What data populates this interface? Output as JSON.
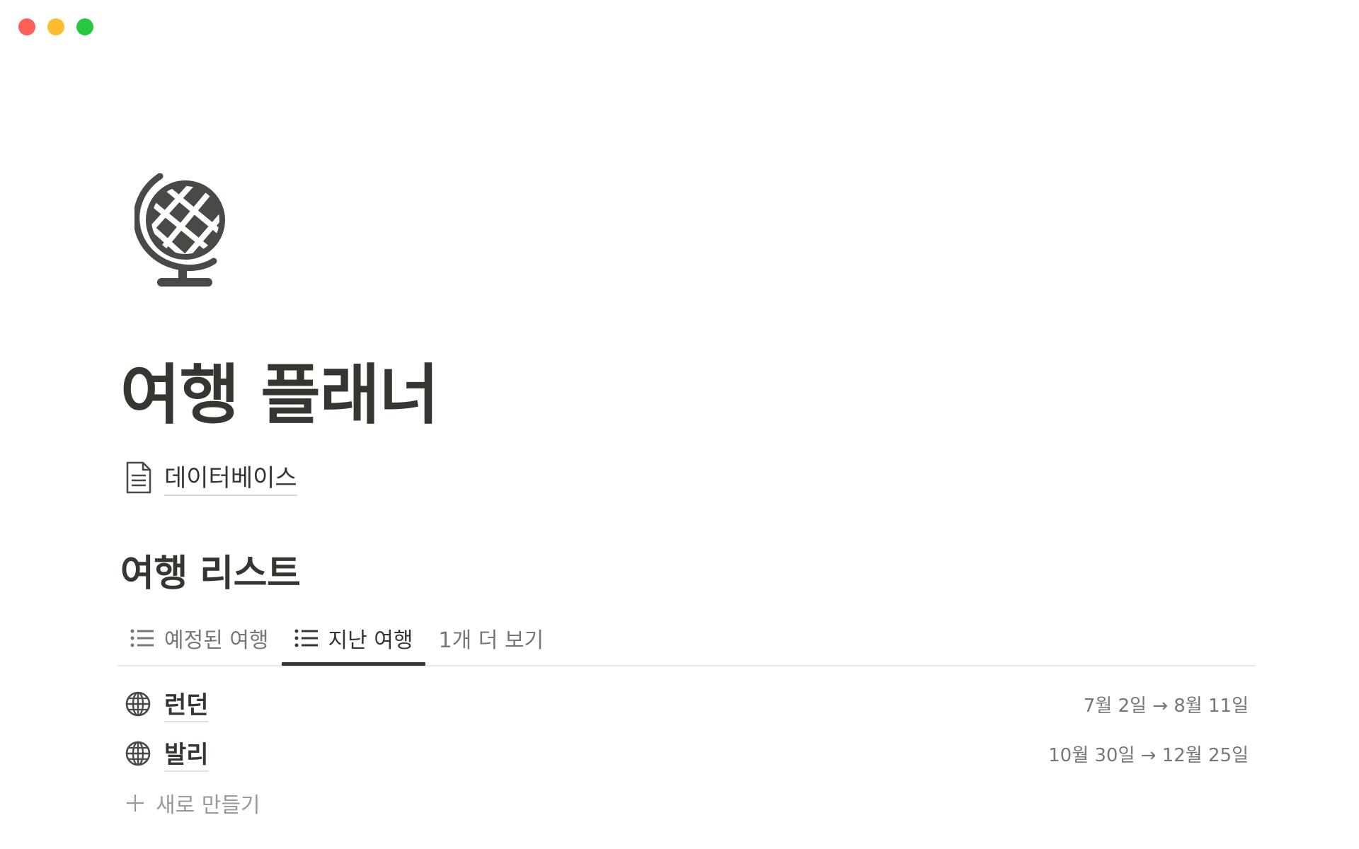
{
  "window": {
    "controls": [
      "close",
      "minimize",
      "zoom"
    ]
  },
  "page": {
    "icon": "globe-icon",
    "title": "여행 플래너"
  },
  "database_link": {
    "icon": "document-icon",
    "label": "데이터베이스"
  },
  "section": {
    "heading": "여행 리스트"
  },
  "tabs": [
    {
      "label": "예정된 여행",
      "icon": "list-icon",
      "active": false
    },
    {
      "label": "지난 여행",
      "icon": "list-icon",
      "active": true
    },
    {
      "label": "1개 더 보기",
      "icon": "",
      "active": false
    }
  ],
  "rows": [
    {
      "name": "런던",
      "icon": "globe-icon",
      "dates": "7월 2일 → 8월 11일"
    },
    {
      "name": "발리",
      "icon": "globe-icon",
      "dates": "10월 30일 → 12월 25일"
    }
  ],
  "new_item": {
    "icon": "plus-icon",
    "label": "새로 만들기"
  },
  "colors": {
    "text": "#37352f",
    "muted": "#787774",
    "close": "#fe5f57",
    "minimize": "#febc2e",
    "zoom": "#28c840"
  }
}
